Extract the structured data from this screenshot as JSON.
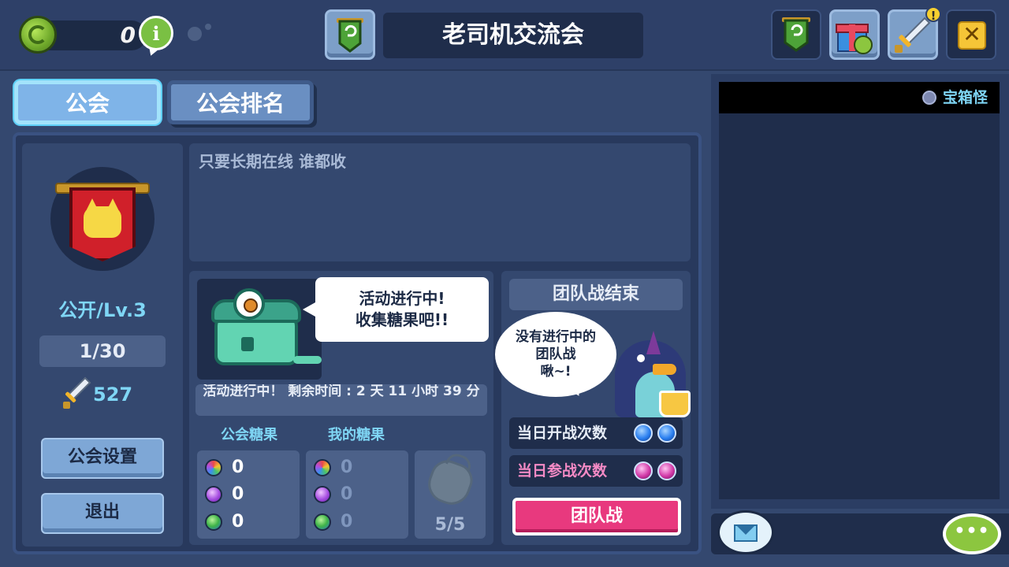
{
  "top_bar": {
    "currency_value": "0",
    "info_icon_glyph": "i",
    "guild_name": "老司机交流会",
    "close_glyph": "✕",
    "alert_glyph": "!"
  },
  "tabs": [
    {
      "label": "公会",
      "active": true
    },
    {
      "label": "公会排名",
      "active": false
    }
  ],
  "guild_info": {
    "visibility_level": "公开/Lv.3",
    "members": "1/30",
    "power": "527",
    "settings_label": "公会设置",
    "quit_label": "退出",
    "notice": "只要长期在线 谁都收"
  },
  "event": {
    "speech_lines": [
      "活动进行中!",
      "收集糖果吧!!"
    ],
    "status": "活动进行中！ 剩余时间 : 2 天 11 小时 39 分",
    "guild_candy_label": "公会糖果",
    "my_candy_label": "我的糖果",
    "guild_candy": [
      "0",
      "0",
      "0"
    ],
    "my_candy": [
      "0",
      "0",
      "0"
    ],
    "bag_count": "5/5"
  },
  "team_battle": {
    "header": "团队战结束",
    "bubble_lines": [
      "没有进行中的",
      "团队战",
      "啾~!"
    ],
    "daily_open_label": "当日开战次数",
    "daily_join_label": "当日参战次数",
    "button_label": "团队战"
  },
  "chat": {
    "channel": "宝箱怪",
    "talk_glyph": "•••"
  },
  "icons": {
    "currency": "green-coin-icon",
    "info": "info-icon",
    "guild_badge": "guild-banner-icon",
    "gift": "gift-icon",
    "sword": "sword-icon",
    "close": "close-icon",
    "mail": "mail-icon",
    "chat": "chat-bubble-icon"
  },
  "colors": {
    "background": "#34486f",
    "accent_cyan": "#7fd6f5",
    "battle_button": "#e8397e",
    "close_button": "#f5c537"
  }
}
